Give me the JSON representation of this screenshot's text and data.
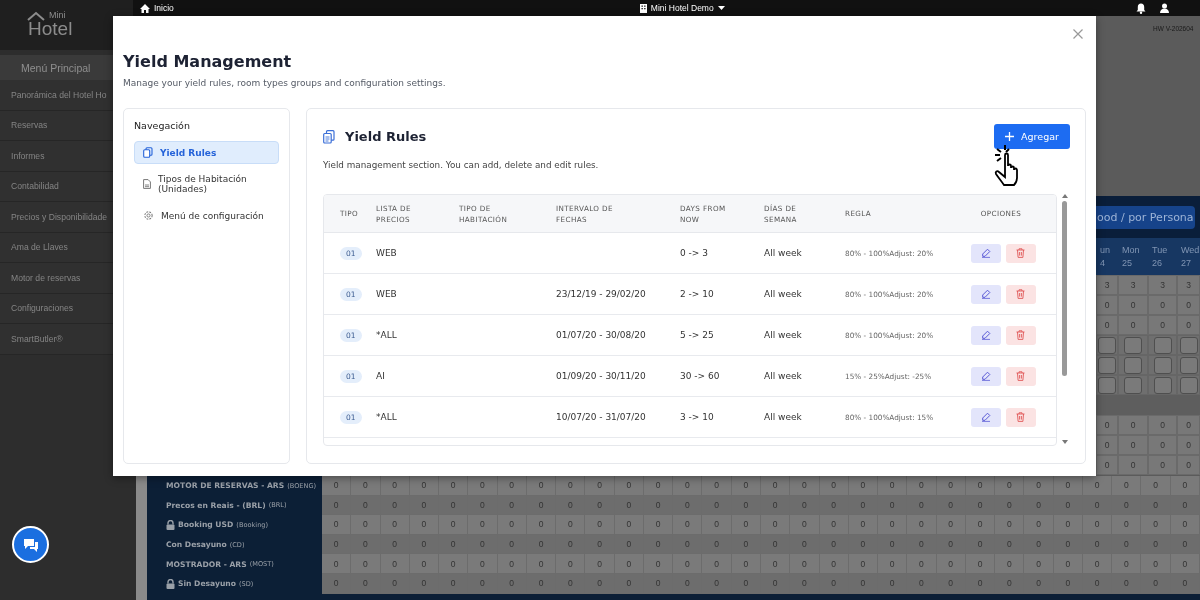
{
  "logo": {
    "small": "Mini",
    "big": "Hotel"
  },
  "topbar": {
    "home": "Inicio",
    "hotel": "Mini Hotel Demo"
  },
  "sidebar": {
    "title": "Menú Principal",
    "items": [
      "Panorámica del Hotel Ho",
      "Reservas",
      "Informes",
      "Contabilidad",
      "Precios y Disponibilidade",
      "Ama de Llaves",
      "Motor de reservas",
      "Configuraciones",
      "SmartButler®"
    ]
  },
  "version": "HW V-202604",
  "rate_panel": {
    "button": "ood / por Persona",
    "days": [
      {
        "name": "un",
        "date": "4"
      },
      {
        "name": "Mon",
        "date": "25"
      },
      {
        "name": "Tue",
        "date": "26"
      },
      {
        "name": "Wed",
        "date": "27"
      }
    ],
    "rows": [
      {
        "kind": "values",
        "values": [
          "3",
          "3",
          "3",
          "3"
        ]
      },
      {
        "kind": "values",
        "values": [
          "0",
          "0",
          "0",
          "0"
        ]
      },
      {
        "kind": "values",
        "values": [
          "0",
          "0",
          "0",
          "0"
        ]
      },
      {
        "kind": "inputs"
      },
      {
        "kind": "inputs"
      },
      {
        "kind": "inputs"
      },
      {
        "kind": "blank"
      },
      {
        "kind": "values",
        "values": [
          "0",
          "0",
          "0",
          "0"
        ]
      },
      {
        "kind": "values",
        "values": [
          "0",
          "0",
          "0",
          "0"
        ]
      },
      {
        "kind": "values",
        "values": [
          "0",
          "0",
          "0",
          "0"
        ]
      }
    ]
  },
  "rates": [
    {
      "name": "MOTOR DE RESERVAS - ARS",
      "code": "(BOENG)",
      "locked": false,
      "values": [
        "0",
        "0",
        "0",
        "0",
        "0",
        "0",
        "0",
        "0",
        "0",
        "0",
        "0",
        "0",
        "0",
        "0",
        "0",
        "0",
        "0",
        "0",
        "0",
        "0",
        "0",
        "0",
        "0",
        "0",
        "0",
        "0",
        "0",
        "0",
        "0",
        "0"
      ]
    },
    {
      "name": "Precos en Reais - (BRL)",
      "code": "(BRL)",
      "locked": false,
      "values": [
        "0",
        "0",
        "0",
        "0",
        "0",
        "0",
        "0",
        "0",
        "0",
        "0",
        "0",
        "0",
        "0",
        "0",
        "0",
        "0",
        "0",
        "0",
        "0",
        "0",
        "0",
        "0",
        "0",
        "0",
        "0",
        "0",
        "0",
        "0",
        "0",
        "0"
      ]
    },
    {
      "name": "Booking USD",
      "code": "(Booking)",
      "locked": true,
      "values": [
        "0",
        "0",
        "0",
        "0",
        "0",
        "0",
        "0",
        "0",
        "0",
        "0",
        "0",
        "0",
        "0",
        "0",
        "0",
        "0",
        "0",
        "0",
        "0",
        "0",
        "0",
        "0",
        "0",
        "0",
        "0",
        "0",
        "0",
        "0",
        "0",
        "0"
      ]
    },
    {
      "name": "Con Desayuno",
      "code": "(CD)",
      "locked": false,
      "values": [
        "0",
        "0",
        "0",
        "0",
        "0",
        "0",
        "0",
        "0",
        "0",
        "0",
        "0",
        "0",
        "0",
        "0",
        "0",
        "0",
        "0",
        "0",
        "0",
        "0",
        "0",
        "0",
        "0",
        "0",
        "0",
        "0",
        "0",
        "0",
        "0",
        "0"
      ]
    },
    {
      "name": "MOSTRADOR - ARS",
      "code": "(MOST)",
      "locked": false,
      "values": [
        "0",
        "0",
        "0",
        "0",
        "0",
        "0",
        "0",
        "0",
        "0",
        "0",
        "0",
        "0",
        "0",
        "0",
        "0",
        "0",
        "0",
        "0",
        "0",
        "0",
        "0",
        "0",
        "0",
        "0",
        "0",
        "0",
        "0",
        "0",
        "0",
        "0"
      ]
    },
    {
      "name": "Sin Desayuno",
      "code": "(SD)",
      "locked": true,
      "values": [
        "0",
        "0",
        "0",
        "0",
        "0",
        "0",
        "0",
        "0",
        "0",
        "0",
        "0",
        "0",
        "0",
        "0",
        "0",
        "0",
        "0",
        "0",
        "0",
        "0",
        "0",
        "0",
        "0",
        "0",
        "0",
        "0",
        "0",
        "0",
        "0",
        "0"
      ]
    }
  ],
  "modal": {
    "title": "Yield Management",
    "subtitle": "Manage your yield rules, room types groups and configuration settings.",
    "nav": {
      "title": "Navegación",
      "items": [
        {
          "label": "Yield Rules",
          "selected": true
        },
        {
          "label": "Tipos de Habitación (Unidades)",
          "selected": false
        },
        {
          "label": "Menú de configuración",
          "selected": false
        }
      ]
    },
    "section": {
      "title": "Yield Rules",
      "description": "Yield management section. You can add, delete and edit rules.",
      "add_button": "Agregar",
      "columns": [
        "TIPO",
        "LISTA DE PRECIOS",
        "TIPO DE HABITACIÓN",
        "INTERVALO DE FECHAS",
        "DAYS FROM NOW",
        "DÍAS DE SEMANA",
        "REGLA",
        "OPCIONES"
      ],
      "rows": [
        {
          "tipo": "01",
          "lista": "WEB",
          "days": "0 -> 3",
          "dias": "All week",
          "regla": "80% - 100%Adjust: 20%"
        },
        {
          "tipo": "01",
          "lista": "WEB",
          "intervalo": "23/12/19 - 29/02/20",
          "days": "2 -> 10",
          "dias": "All week",
          "regla": "80% - 100%Adjust: 20%"
        },
        {
          "tipo": "01",
          "lista": "*ALL",
          "intervalo": "01/07/20 - 30/08/20",
          "days": "5 -> 25",
          "dias": "All week",
          "regla": "80% - 100%Adjust: 20%"
        },
        {
          "tipo": "01",
          "lista": "AI",
          "intervalo": "01/09/20 - 30/11/20",
          "days": "30 -> 60",
          "dias": "All week",
          "regla": "15% - 25%Adjust: -25%"
        },
        {
          "tipo": "01",
          "lista": "*ALL",
          "intervalo": "10/07/20 - 31/07/20",
          "days": "3 -> 10",
          "dias": "All week",
          "regla": "80% - 100%Adjust: 15%"
        }
      ]
    }
  }
}
